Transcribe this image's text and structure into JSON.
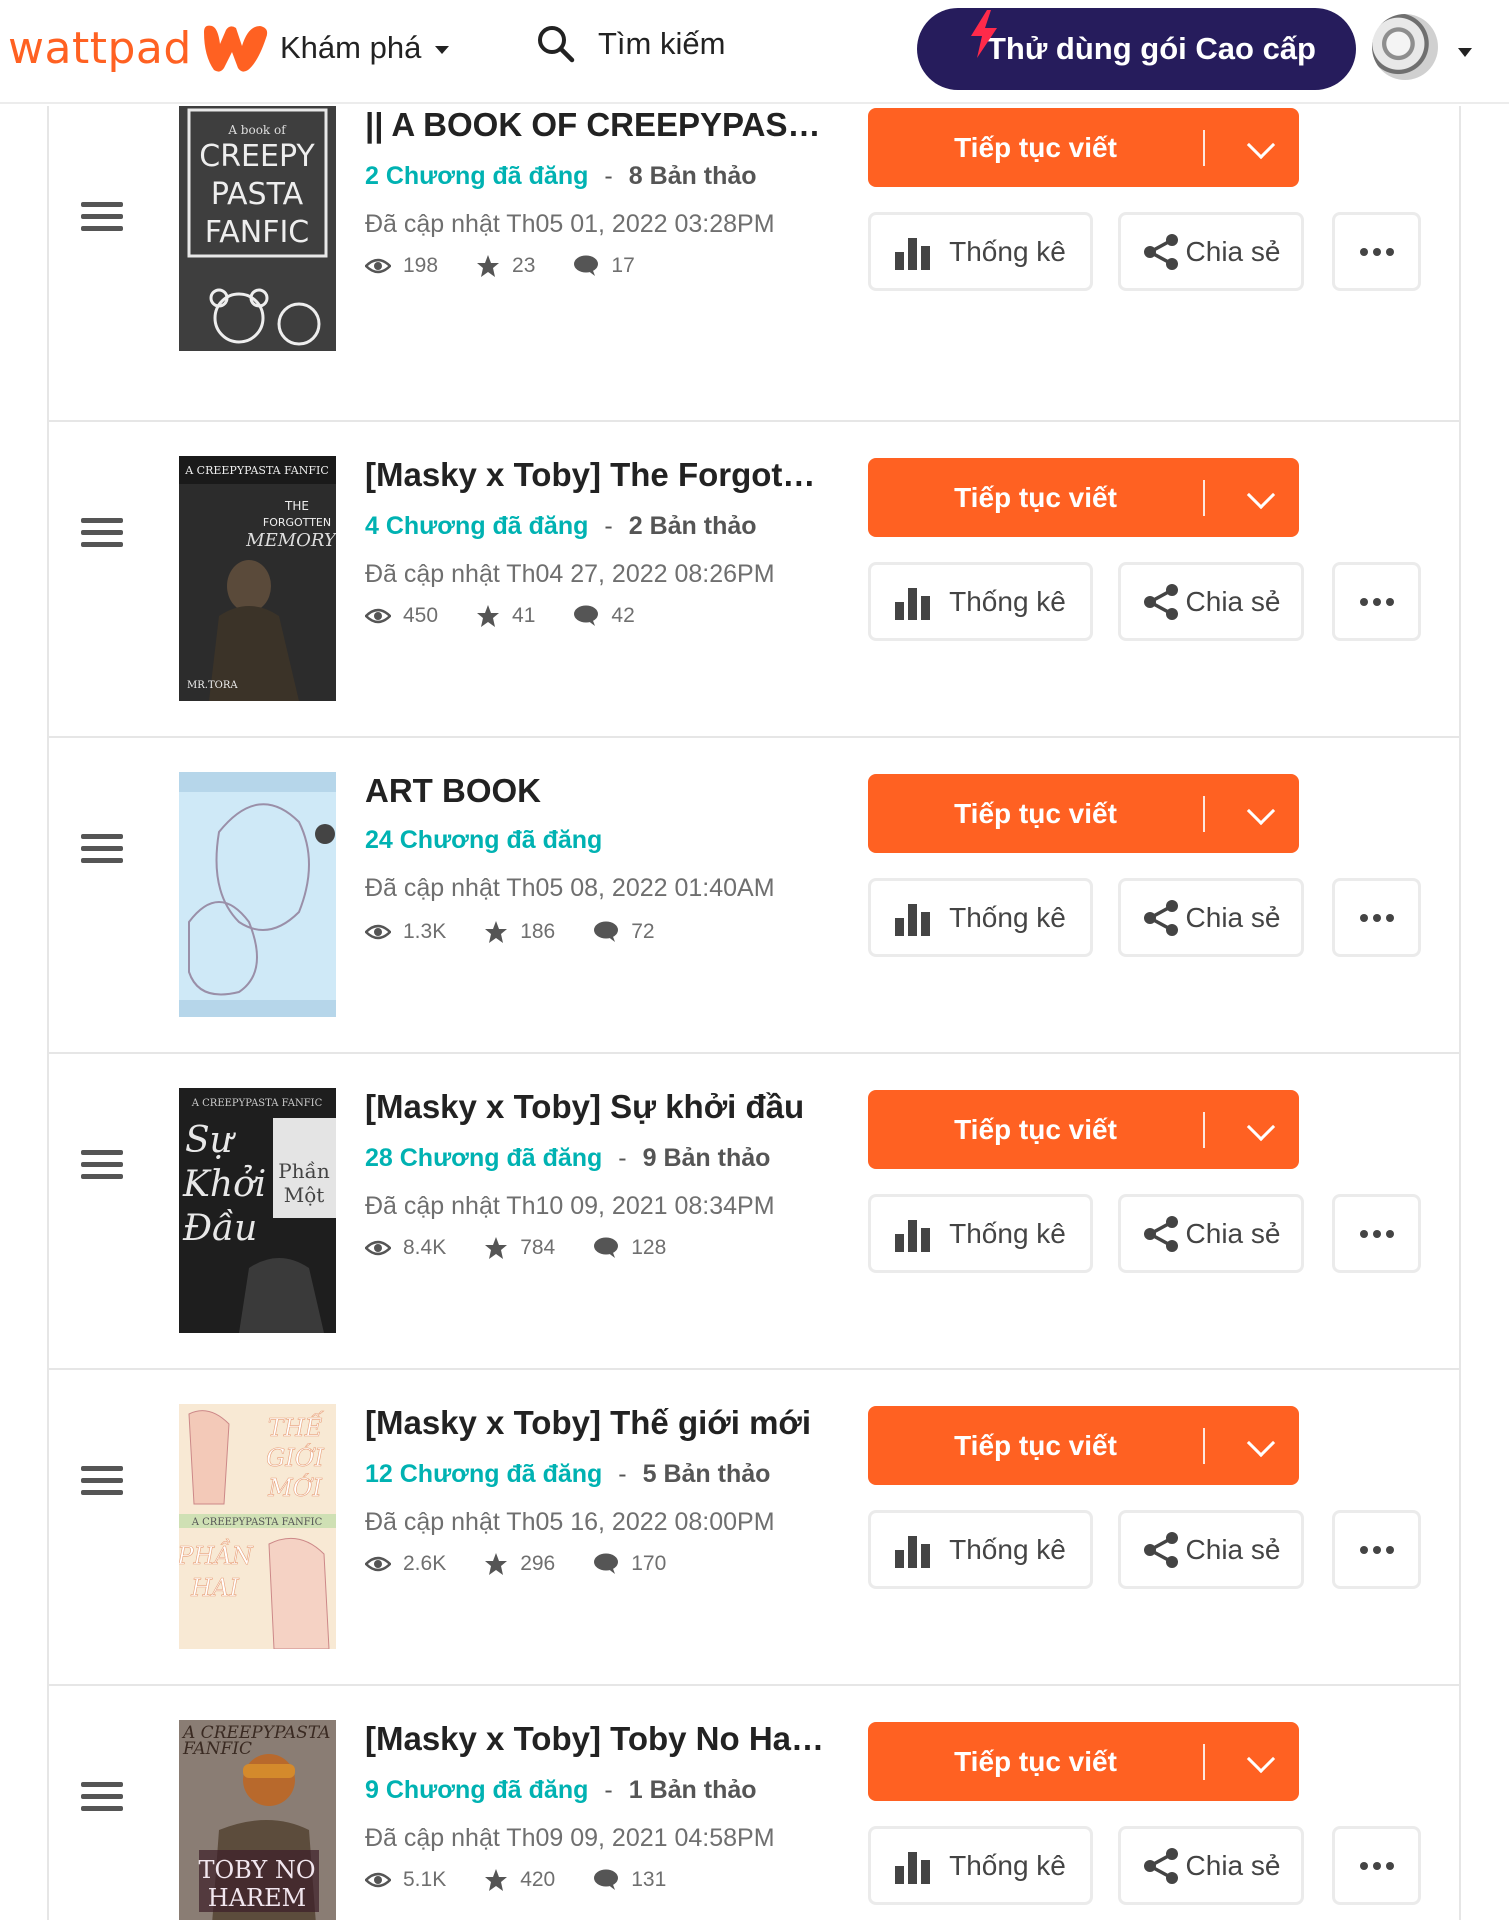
{
  "header": {
    "logo_text": "wattpad",
    "discover_label": "Khám phá",
    "search_label": "Tìm kiếm",
    "premium_label": "Thử dùng gói Cao cấp",
    "brand_color": "#ff6122",
    "premium_color": "#261c5c"
  },
  "labels": {
    "continue": "Tiếp tục viết",
    "stats": "Thống kê",
    "share": "Chia sẻ"
  },
  "stories": [
    {
      "title": "|| A BOOK OF CREEPYPASTA FANFIC ||",
      "published": "2 Chương đã đăng",
      "drafts": "8 Bản thảo",
      "updated": "Đã cập nhật Th05 01, 2022 03:28PM",
      "reads": "198",
      "votes": "23",
      "comments": "17",
      "cover_text": [
        "A book of",
        "CREEPY",
        "PASTA",
        "FANFIC"
      ]
    },
    {
      "title": "[Masky x Toby] The Forgotten Memory",
      "published": "4 Chương đã đăng",
      "drafts": "2 Bản thảo",
      "updated": "Đã cập nhật Th04 27, 2022 08:26PM",
      "reads": "450",
      "votes": "41",
      "comments": "42",
      "cover_text": [
        "A CREEPYPASTA FANFIC",
        "THE",
        "FORGOTTEN",
        "MEMORY",
        "MR.TORA"
      ]
    },
    {
      "title": "ART BOOK",
      "published": "24 Chương đã đăng",
      "drafts": "",
      "updated": "Đã cập nhật Th05 08, 2022 01:40AM",
      "reads": "1.3K",
      "votes": "186",
      "comments": "72",
      "cover_text": []
    },
    {
      "title": "[Masky x Toby] Sự khởi đầu",
      "published": "28 Chương đã đăng",
      "drafts": "9 Bản thảo",
      "updated": "Đã cập nhật Th10 09, 2021 08:34PM",
      "reads": "8.4K",
      "votes": "784",
      "comments": "128",
      "cover_text": [
        "A CREEPYPASTA FANFIC",
        "Sự",
        "Khởi",
        "Đầu",
        "Phần",
        "Một"
      ]
    },
    {
      "title": "[Masky x Toby] Thế giới mới",
      "published": "12 Chương đã đăng",
      "drafts": "5 Bản thảo",
      "updated": "Đã cập nhật Th05 16, 2022 08:00PM",
      "reads": "2.6K",
      "votes": "296",
      "comments": "170",
      "cover_text": [
        "THẾ",
        "GIỚI",
        "MỚI",
        "A CREEPYPASTA FANFIC",
        "PHẦN",
        "HAI"
      ]
    },
    {
      "title": "[Masky x Toby] Toby No Harem",
      "published": "9 Chương đã đăng",
      "drafts": "1 Bản thảo",
      "updated": "Đã cập nhật Th09 09, 2021 04:58PM",
      "reads": "5.1K",
      "votes": "420",
      "comments": "131",
      "cover_text": [
        "A CREEPYPASTA",
        "FANFIC",
        "TOBY NO",
        "HAREM"
      ]
    }
  ]
}
